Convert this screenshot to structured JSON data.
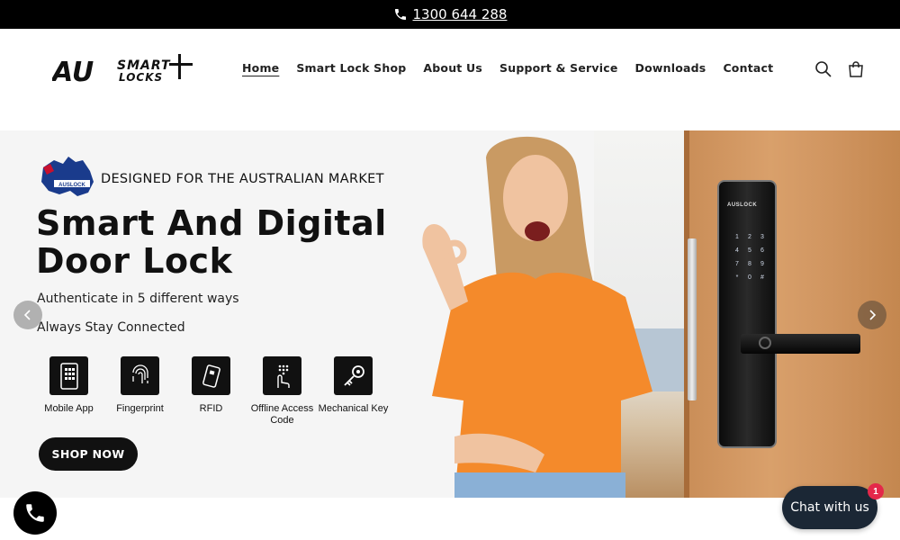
{
  "announcement": {
    "phone": "1300 644 288",
    "icon": "phone-icon"
  },
  "header": {
    "logo": {
      "big": "AU",
      "line1": "SMART",
      "line2": "LOCKS"
    },
    "nav": [
      {
        "label": "Home",
        "active": true
      },
      {
        "label": "Smart Lock Shop"
      },
      {
        "label": "About Us"
      },
      {
        "label": "Support & Service"
      },
      {
        "label": "Downloads"
      },
      {
        "label": "Contact"
      }
    ],
    "icons": [
      "search-icon",
      "cart-icon"
    ]
  },
  "hero": {
    "badge_text": "DESIGNED FOR THE AUSTRALIAN MARKET",
    "map_label": "AUSLOCK",
    "title_line1": "Smart And Digital",
    "title_line2": "Door Lock",
    "subtitle1": "Authenticate in 5 different ways",
    "subtitle2": "Always Stay Connected",
    "features": [
      {
        "label": "Mobile App",
        "icon": "mobile-app-icon"
      },
      {
        "label": "Fingerprint",
        "icon": "fingerprint-icon"
      },
      {
        "label": "RFID",
        "icon": "rfid-card-icon"
      },
      {
        "label": "Offline Access Code",
        "icon": "keypad-icon"
      },
      {
        "label": "Mechanical Key",
        "icon": "key-icon"
      }
    ],
    "cta": "SHOP NOW",
    "lock_brand": "AUSLOCK",
    "lock_keys": [
      "1",
      "2",
      "3",
      "4",
      "5",
      "6",
      "7",
      "8",
      "9",
      "*",
      "0",
      "#"
    ]
  },
  "widgets": {
    "chat_label": "Chat with us",
    "chat_badge": "1"
  },
  "colors": {
    "topbar": "#000000",
    "cta": "#111111",
    "chat": "#1b2735",
    "badge": "#e4284a"
  }
}
